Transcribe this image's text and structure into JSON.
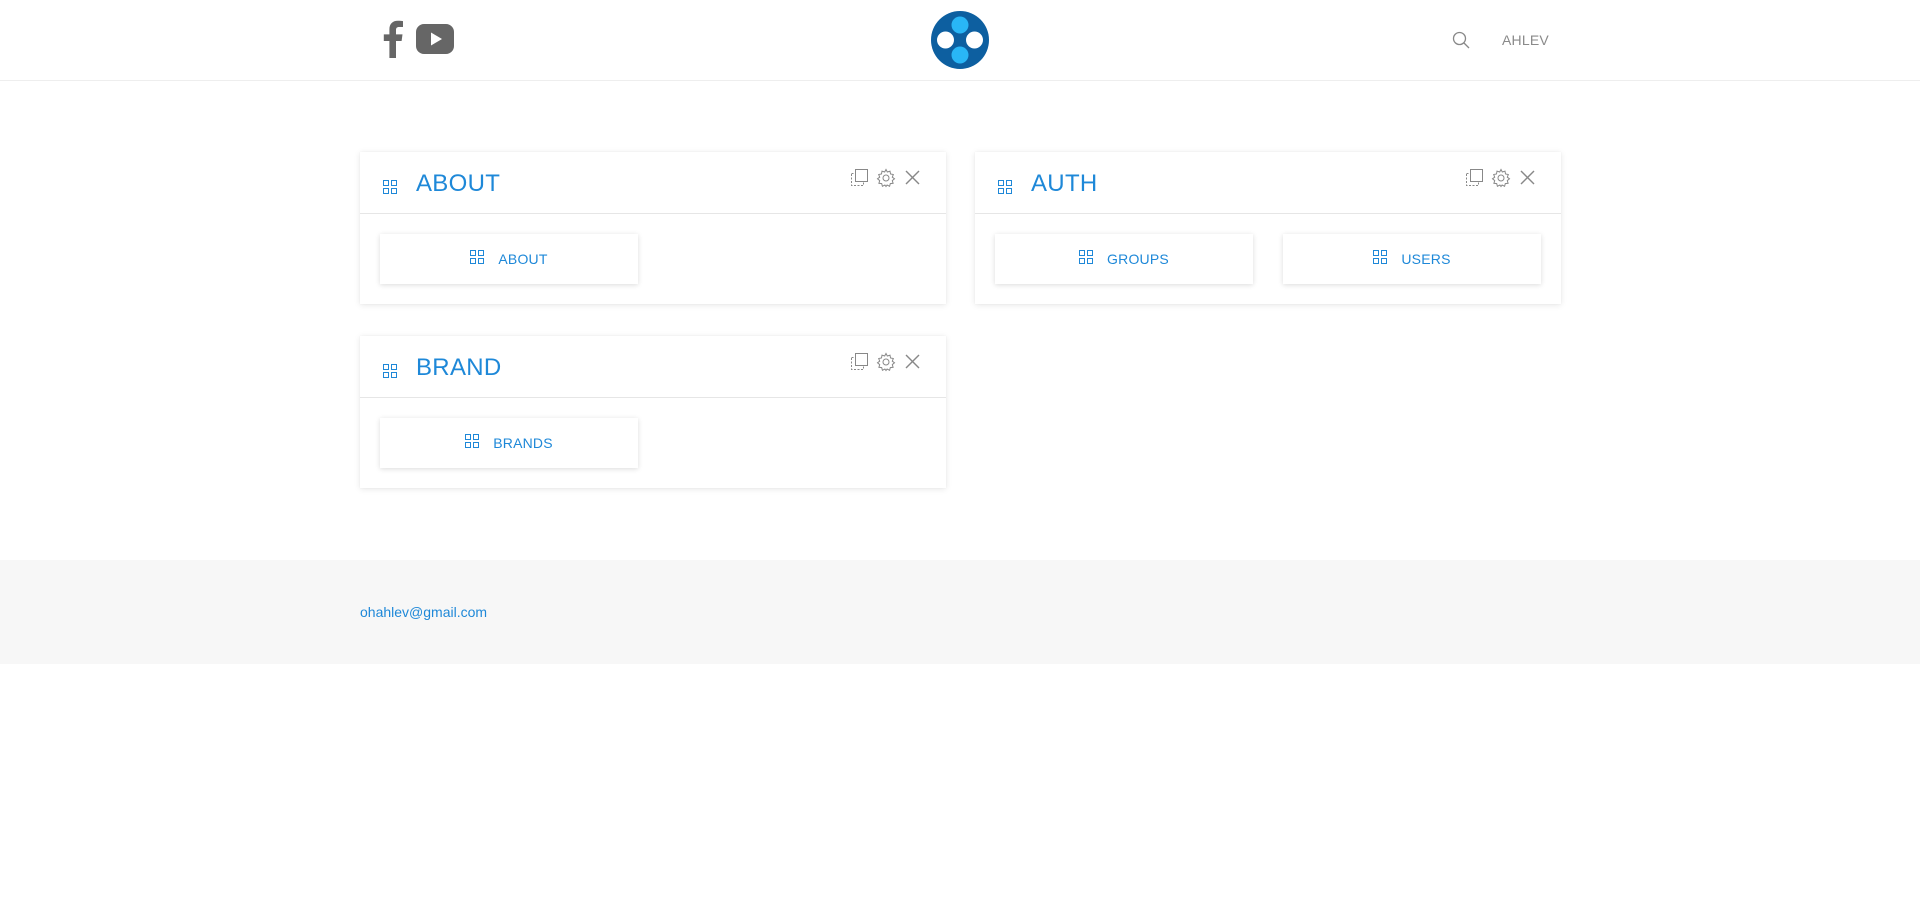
{
  "header": {
    "social": [
      {
        "icon": "facebook-icon"
      },
      {
        "icon": "youtube-icon"
      }
    ],
    "logo_icon": "app-logo",
    "search_icon": "search-icon",
    "user_name": "AHLEV"
  },
  "colors": {
    "accent": "#1e88d8",
    "logo_dark": "#0d5fa0",
    "logo_light": "#29b6f6",
    "footer_bg": "#f7f7f7"
  },
  "cards": [
    {
      "title": "ABOUT",
      "tiles": [
        {
          "label": "ABOUT"
        }
      ]
    },
    {
      "title": "AUTH",
      "tiles": [
        {
          "label": "GROUPS"
        },
        {
          "label": "USERS"
        }
      ]
    },
    {
      "title": "BRAND",
      "tiles": [
        {
          "label": "BRANDS"
        }
      ]
    }
  ],
  "footer": {
    "email": "ohahlev@gmail.com"
  }
}
